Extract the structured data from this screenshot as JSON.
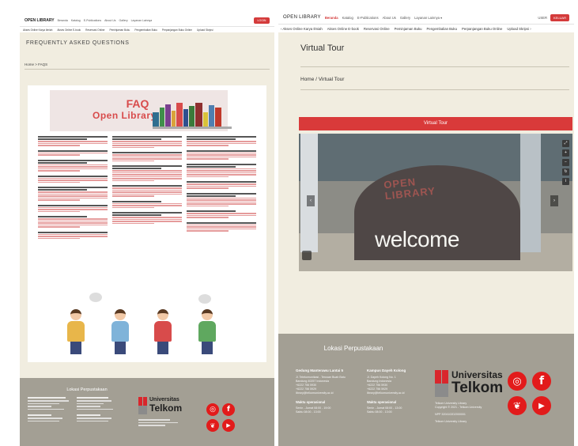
{
  "left": {
    "header": {
      "brand": "OPEN LIBRARY",
      "menu": [
        "Beranda",
        "Katalog",
        "E-Publications",
        "About Us",
        "Gallery",
        "Layanan Lainnya"
      ],
      "login_btn": "LOGIN"
    },
    "subnav": [
      "Akses Online Karya Ilmiah",
      "Akses Online E-book",
      "Reservasi Online",
      "Peminjaman Buku",
      "Pengembalian Buku",
      "Perpanjangan Buku Online",
      "Upload Skripsi"
    ],
    "page_title": "FREQUENTLY ASKED QUESTIONS",
    "breadcrumb": "Home > FAQS",
    "poster": {
      "title": "FAQ",
      "subtitle": "Open Library"
    },
    "footer": {
      "title": "Lokasi Perpustakaan"
    }
  },
  "right": {
    "header": {
      "brand": "OPEN LIBRARY",
      "menu": [
        "Beranda",
        "Katalog",
        "E-Publications",
        "About Us",
        "Gallery",
        "Layanan Lainnya ▾"
      ],
      "user_label": "USER",
      "login_btn": "KELUAR"
    },
    "subnav": [
      "‹ Akses Online Karya Ilmiah",
      "Akses Online E-book",
      "Reservasi Online",
      "Peminjaman Buku",
      "Pengembalian Buku",
      "Perpanjangan Buku Online",
      "Upload Skripsi ›"
    ],
    "page_title": "Virtual Tour",
    "breadcrumb": "Home / Virtual Tour",
    "section_bar": "Virtual Tour",
    "tour": {
      "sign_line1": "OPEN",
      "sign_line2": "LIBRARY",
      "welcome": "welcome"
    },
    "footer": {
      "title": "Lokasi Perpustakaan",
      "col1": {
        "heading": "Gedung Manterawu Lantai 5",
        "lines": [
          "Jl. Telekomunikasi - Terusan Buah Batu",
          "Bandung 40257 Indonesia",
          "+6222 756 5930",
          "+6222 756 5929",
          "library@telkomuniversity.ac.id"
        ],
        "hours_heading": "Waktu operasional",
        "hours": [
          "Senin - Jumat  08:00 - 19:00",
          "Sabtu           08:00 - 13:00"
        ]
      },
      "col2": {
        "heading": "Kampus Dayeh Kolong",
        "lines": [
          "Jl. Dayeh Kolong No. 1",
          "Bandung Indonesia",
          "+6222 756 5930",
          "+6222 756 5929",
          "library@telkomuniversity.ac.id"
        ],
        "hours_heading": "Waktu operasional",
        "hours": [
          "Senin - Jumat  08:00 - 13:00",
          "Sabtu           08:00 - 13:00"
        ]
      },
      "logo_line1": "Universitas",
      "logo_line2": "Telkom",
      "logo_info": [
        "Telkom University Library",
        "Copyright © 2021 - Telkom University",
        "NPP 3204102D2000001",
        "Telkom University Library"
      ]
    }
  },
  "social": {
    "icons": [
      "instagram-icon",
      "facebook-icon",
      "twitter-icon",
      "youtube-icon"
    ],
    "glyphs": [
      "◎",
      "f",
      "❦",
      "▶"
    ]
  },
  "colors": {
    "accent_red": "#d93a3a",
    "panel_bg": "#f1ede0",
    "footer_bg": "#a39f94"
  }
}
